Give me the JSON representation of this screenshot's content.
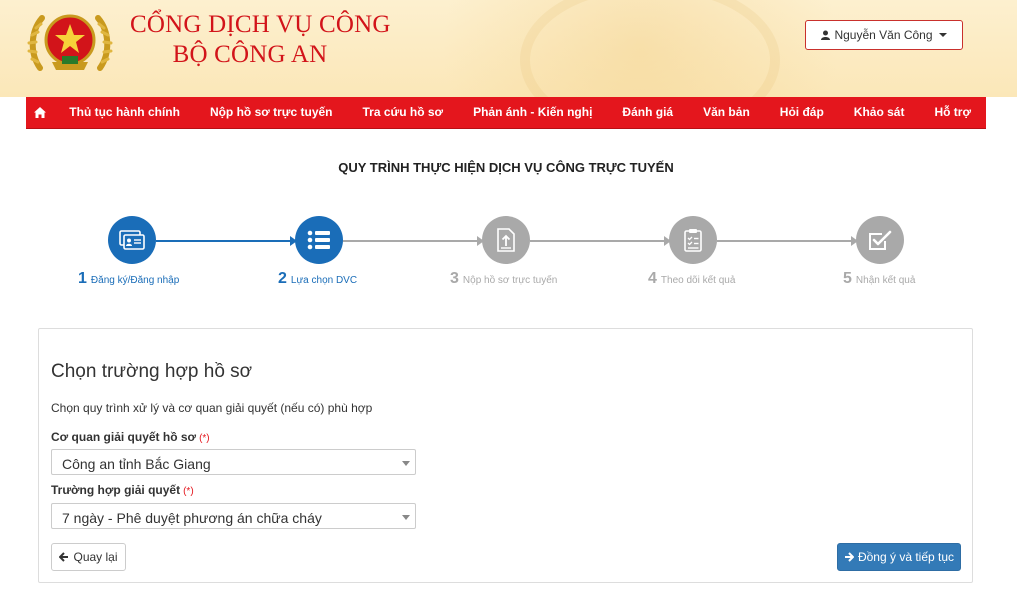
{
  "header": {
    "title_line1": "CỔNG DỊCH VỤ CÔNG",
    "title_line2": "BỘ CÔNG AN",
    "user_name": "Nguyễn Văn Công",
    "title_color": "#d2141a"
  },
  "nav": {
    "home_icon": "home-icon",
    "items": [
      "Thủ tục hành chính",
      "Nộp hồ sơ trực tuyến",
      "Tra cứu hồ sơ",
      "Phản ánh - Kiến nghị",
      "Đánh giá",
      "Văn bản",
      "Hỏi đáp",
      "Khảo sát",
      "Hỗ trợ"
    ],
    "color": "#e4161d"
  },
  "process": {
    "title": "QUY TRÌNH THỰC HIỆN DỊCH VỤ CÔNG TRỰC TUYẾN",
    "active_color": "#1a6db8",
    "inactive_color": "#a9a9a9",
    "steps": [
      {
        "num": "1",
        "label": "Đăng ký/Đăng nhập",
        "icon": "id-card-icon",
        "active": true
      },
      {
        "num": "2",
        "label": "Lựa chọn DVC",
        "icon": "list-icon",
        "active": true
      },
      {
        "num": "3",
        "label": "Nộp hồ sơ trực tuyến",
        "icon": "document-upload-icon",
        "active": false
      },
      {
        "num": "4",
        "label": "Theo dõi kết quả",
        "icon": "clipboard-list-icon",
        "active": false
      },
      {
        "num": "5",
        "label": "Nhận kết quả",
        "icon": "check-square-icon",
        "active": false
      }
    ]
  },
  "form": {
    "title": "Chọn trường hợp hồ sơ",
    "description": "Chọn quy trình xử lý và cơ quan giải quyết (nếu có) phù hợp",
    "agency_label": "Cơ quan giải quyết hồ sơ",
    "agency_value": "Công an tỉnh Bắc Giang",
    "case_label": "Trường hợp giải quyết",
    "case_value": "7 ngày - Phê duyệt phương án chữa cháy",
    "required_mark": "(*)",
    "back_label": "Quay lại",
    "next_label": "Đồng ý và tiếp tục"
  }
}
